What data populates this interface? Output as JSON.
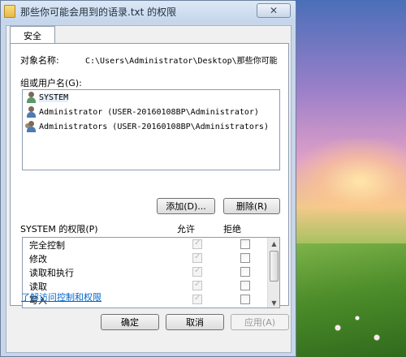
{
  "window": {
    "title": "那些你可能会用到的语录.txt 的权限",
    "close_glyph": "✕"
  },
  "tabs": [
    {
      "label": "安全"
    }
  ],
  "object": {
    "label": "对象名称:",
    "value": "C:\\Users\\Administrator\\Desktop\\那些你可能"
  },
  "users": {
    "label": "组或用户名(G):",
    "items": [
      {
        "name": "SYSTEM",
        "icon": "system-user-icon"
      },
      {
        "name": "Administrator (USER-20160108BP\\Administrator)",
        "icon": "user-icon"
      },
      {
        "name": "Administrators (USER-20160108BP\\Administrators)",
        "icon": "group-icon"
      }
    ]
  },
  "buttons": {
    "add": "添加(D)...",
    "remove": "删除(R)",
    "ok": "确定",
    "cancel": "取消",
    "apply": "应用(A)"
  },
  "permissions": {
    "label": "SYSTEM 的权限(P)",
    "col_allow": "允许",
    "col_deny": "拒绝",
    "rows": [
      {
        "name": "完全控制",
        "allow": true,
        "deny": false
      },
      {
        "name": "修改",
        "allow": true,
        "deny": false
      },
      {
        "name": "读取和执行",
        "allow": true,
        "deny": false
      },
      {
        "name": "读取",
        "allow": true,
        "deny": false
      },
      {
        "name": "写入",
        "allow": true,
        "deny": false
      }
    ]
  },
  "help_link": "了解访问控制和权限"
}
